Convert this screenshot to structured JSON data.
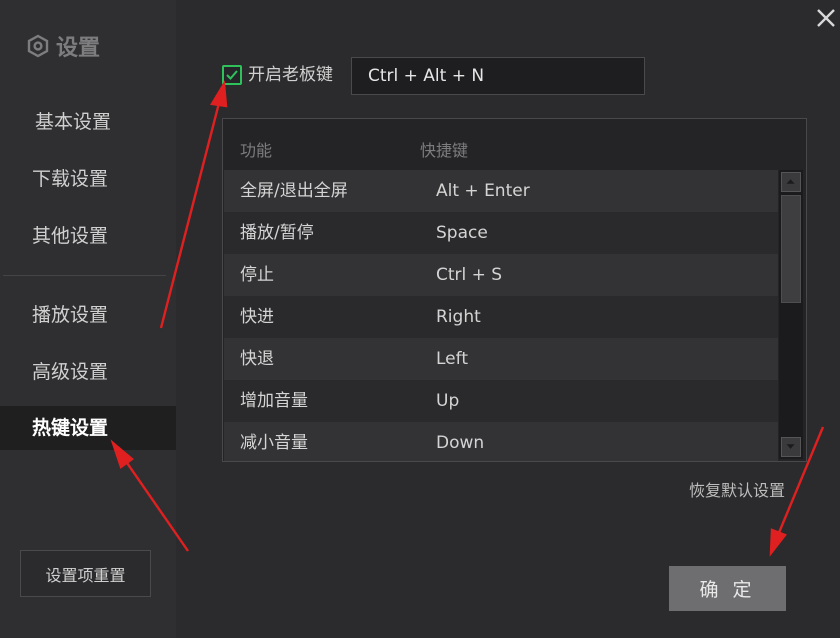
{
  "sidebar": {
    "title": "设置",
    "items": [
      {
        "label": "基本设置"
      },
      {
        "label": "下载设置"
      },
      {
        "label": "其他设置"
      },
      {
        "label": "播放设置"
      },
      {
        "label": "高级设置"
      },
      {
        "label": "热键设置",
        "active": true
      }
    ],
    "reset_button": "设置项重置"
  },
  "boss_key": {
    "checked": true,
    "label": "开启老板键",
    "value": "Ctrl + Alt + N"
  },
  "hotkey_table": {
    "headers": [
      "功能",
      "快捷键"
    ],
    "rows": [
      {
        "function": "全屏/退出全屏",
        "shortcut": "Alt + Enter"
      },
      {
        "function": "播放/暂停",
        "shortcut": "Space"
      },
      {
        "function": "停止",
        "shortcut": "Ctrl + S"
      },
      {
        "function": "快进",
        "shortcut": "Right"
      },
      {
        "function": "快退",
        "shortcut": "Left"
      },
      {
        "function": "增加音量",
        "shortcut": "Up"
      },
      {
        "function": "减小音量",
        "shortcut": "Down"
      }
    ]
  },
  "restore_defaults": "恢复默认设置",
  "ok_button": "确 定",
  "colors": {
    "accent_check": "#2fc25b",
    "annotation_arrow": "#e02020"
  }
}
